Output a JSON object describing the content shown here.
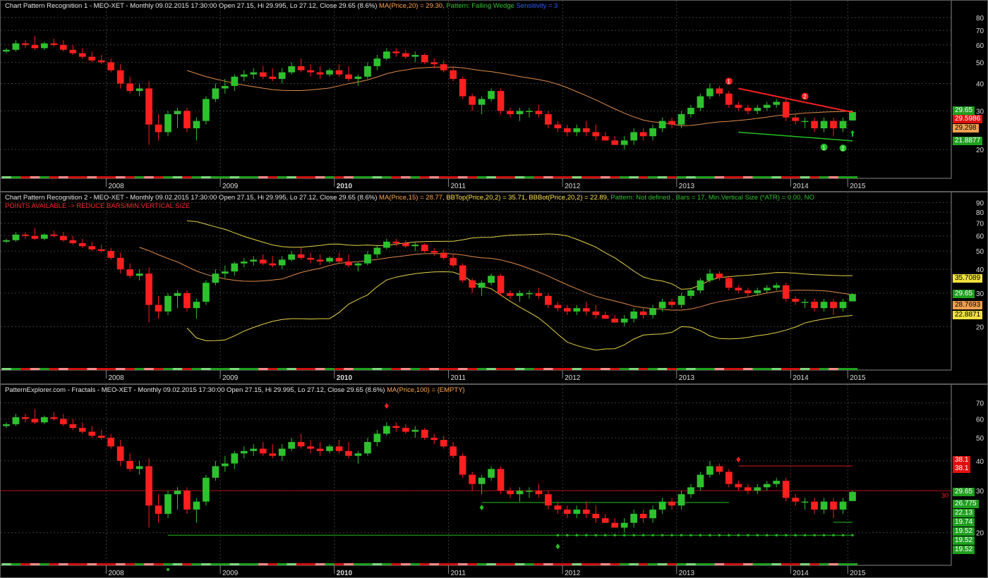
{
  "panes": [
    {
      "name": "pane-1",
      "header": {
        "main": "Chart Pattern Recognition 1  - MEO-XET - Monthly 09.02.2015 17:30:00 Open 27.15, Hi 29.995, Lo 27.12, Close 29.65 (8.6%)",
        "ma": "MA(Price,20) = 29.30,",
        "pattern": "Pattern: Falling Wedge",
        "sensitivity": "Sensitivity = 3"
      },
      "axis_ticks": [
        "80",
        "70",
        "60",
        "50",
        "40",
        "30",
        "20"
      ],
      "tags": [
        "29.65",
        "29.5986",
        "29.298",
        "21.8877"
      ],
      "markers": [
        "1",
        "2",
        "1",
        "2"
      ]
    },
    {
      "name": "pane-2",
      "header": {
        "main": "Chart Pattern Recognition 2 - MEO-XET - Monthly 09.02.2015 17:30:00 Open 27.15, Hi 29.995, Lo 27.12, Close 29.65 (8.6%)",
        "ma": "MA(Price,15) = 28.77,",
        "bbtop": "BBTop(Price,20,2) = 35.71,",
        "bbbot": "BBBot(Price,20,2) = 22.89,",
        "pattern": "Pattern: Not defined , Bars = 17, Min.Vertical Size (*ATR) = 0.00, NO",
        "line2": "POINTS AVAILABLE -> REDUCE BARS/MIN.VERTICAL SIZE"
      },
      "axis_ticks": [
        "90",
        "80",
        "70",
        "60",
        "50",
        "40",
        "30",
        "20"
      ],
      "tags": [
        "35.7089",
        "29.65",
        "28.7693",
        "22.8871"
      ]
    },
    {
      "name": "pane-3",
      "header": {
        "main": "PatternExplorer.com - Fractals - MEO-XET - Monthly 09.02.2015 17:30:00 Open 27.15, Hi 29.995, Lo 27.12, Close 29.65 (8.6%)",
        "ma": "MA(Price,100) = {EMPTY}"
      },
      "axis_ticks": [
        "70",
        "60",
        "50",
        "40",
        "30",
        "20"
      ],
      "tags": [
        "38.1",
        "38.1",
        "29.65",
        "26.775",
        "22.13",
        "19.74",
        "19.52",
        "19.52",
        "19.52"
      ],
      "level_label": "30"
    }
  ],
  "years": [
    "2008",
    "2009",
    "2010",
    "2011",
    "2012",
    "2013",
    "2014",
    "2015"
  ],
  "colors": {
    "up": "#2ec12e",
    "down": "#ff1f1f",
    "ma": "#e08a4a",
    "bb": "#e6d24a",
    "grid": "#3a3a3a"
  },
  "chart_data": {
    "type": "candlestick",
    "symbol": "MEO-XET",
    "interval": "Monthly",
    "ohlc": [
      [
        56,
        58,
        55,
        57
      ],
      [
        57,
        63,
        56,
        61
      ],
      [
        61,
        63,
        58,
        60
      ],
      [
        60,
        66,
        57,
        58
      ],
      [
        58,
        62,
        57,
        61
      ],
      [
        61,
        64,
        59,
        60
      ],
      [
        60,
        63,
        56,
        57
      ],
      [
        57,
        60,
        54,
        55
      ],
      [
        55,
        58,
        52,
        53
      ],
      [
        53,
        56,
        50,
        51
      ],
      [
        51,
        54,
        49,
        50
      ],
      [
        50,
        52,
        45,
        46
      ],
      [
        46,
        49,
        38,
        40
      ],
      [
        40,
        43,
        36,
        37
      ],
      [
        37,
        40,
        35,
        38
      ],
      [
        38,
        41,
        21,
        26
      ],
      [
        26,
        29,
        22,
        24
      ],
      [
        24,
        30,
        23,
        29
      ],
      [
        29,
        31,
        25,
        30
      ],
      [
        30,
        31,
        24,
        25
      ],
      [
        25,
        28,
        22,
        27
      ],
      [
        27,
        35,
        26,
        34
      ],
      [
        34,
        40,
        33,
        38
      ],
      [
        38,
        42,
        36,
        39
      ],
      [
        39,
        44,
        37,
        43
      ],
      [
        43,
        46,
        41,
        44
      ],
      [
        44,
        47,
        42,
        45
      ],
      [
        45,
        48,
        42,
        43
      ],
      [
        43,
        47,
        41,
        42
      ],
      [
        42,
        47,
        40,
        45
      ],
      [
        45,
        50,
        44,
        48
      ],
      [
        48,
        52,
        45,
        46
      ],
      [
        46,
        49,
        43,
        45
      ],
      [
        45,
        48,
        42,
        44
      ],
      [
        44,
        47,
        43,
        46
      ],
      [
        46,
        49,
        43,
        44
      ],
      [
        44,
        48,
        41,
        42
      ],
      [
        42,
        44,
        39,
        43
      ],
      [
        43,
        50,
        42,
        48
      ],
      [
        48,
        54,
        46,
        52
      ],
      [
        52,
        58,
        51,
        56
      ],
      [
        56,
        58,
        53,
        55
      ],
      [
        55,
        57,
        52,
        53
      ],
      [
        53,
        56,
        50,
        54
      ],
      [
        54,
        55,
        49,
        50
      ],
      [
        50,
        52,
        47,
        49
      ],
      [
        49,
        51,
        45,
        46
      ],
      [
        46,
        48,
        41,
        42
      ],
      [
        42,
        43,
        34,
        35
      ],
      [
        35,
        36,
        30,
        32
      ],
      [
        32,
        35,
        29,
        34
      ],
      [
        34,
        38,
        33,
        37
      ],
      [
        37,
        38,
        29,
        30
      ],
      [
        30,
        31,
        28,
        29
      ],
      [
        29,
        31,
        27,
        30
      ],
      [
        30,
        31,
        28,
        30
      ],
      [
        30,
        32,
        28,
        29
      ],
      [
        29,
        30,
        25,
        26
      ],
      [
        26,
        27,
        24,
        25
      ],
      [
        25,
        26,
        23,
        24
      ],
      [
        24,
        26,
        23,
        25
      ],
      [
        25,
        27,
        23,
        24
      ],
      [
        24,
        26,
        22,
        23
      ],
      [
        23,
        24,
        22,
        22
      ],
      [
        22,
        23,
        21,
        21
      ],
      [
        21,
        23,
        20,
        22
      ],
      [
        22,
        25,
        21,
        24
      ],
      [
        24,
        25,
        22,
        23
      ],
      [
        23,
        26,
        22,
        25
      ],
      [
        25,
        28,
        24,
        27
      ],
      [
        27,
        28,
        25,
        26
      ],
      [
        26,
        30,
        25,
        29
      ],
      [
        29,
        32,
        28,
        31
      ],
      [
        31,
        36,
        30,
        35
      ],
      [
        35,
        40,
        34,
        38
      ],
      [
        38,
        39,
        35,
        36
      ],
      [
        36,
        37,
        31,
        32
      ],
      [
        32,
        33,
        30,
        31
      ],
      [
        31,
        32,
        29,
        30
      ],
      [
        30,
        32,
        29,
        31
      ],
      [
        31,
        33,
        30,
        32
      ],
      [
        32,
        34,
        31,
        33
      ],
      [
        33,
        34,
        27,
        28
      ],
      [
        28,
        29,
        26,
        27
      ],
      [
        27,
        28,
        25,
        27
      ],
      [
        27,
        28,
        24,
        25
      ],
      [
        25,
        28,
        24,
        27
      ],
      [
        27,
        28,
        23,
        25
      ],
      [
        25,
        28,
        24,
        27
      ],
      [
        27.15,
        29.995,
        27.12,
        29.65
      ]
    ],
    "log_scale": true,
    "y_range": [
      15,
      90
    ]
  }
}
